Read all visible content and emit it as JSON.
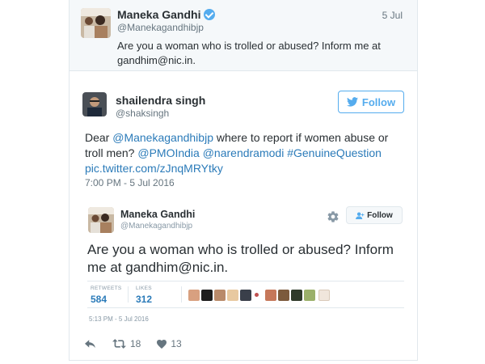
{
  "parent_tweet": {
    "name": "Maneka Gandhi",
    "handle": "@Manekagandhibjp",
    "date": "5 Jul",
    "text": "Are you a woman who is trolled or abused? Inform me at gandhim@nic.in."
  },
  "main_tweet": {
    "name": "shailendra singh",
    "handle": "@shaksingh",
    "follow_label": "Follow",
    "body": {
      "dear": "Dear ",
      "mention1": "@Manekagandhibjp",
      "text1": " where to report if women abuse or troll men? ",
      "mention2": "@PMOIndia",
      "space1": " ",
      "mention3": "@narendramodi",
      "space2": " ",
      "hashtag": "#GenuineQuestion",
      "link": "pic.twitter.com/zJnqMRYtky"
    },
    "timestamp": "7:00 PM - 5 Jul 2016",
    "replies_icon": "reply-icon",
    "retweet_count": "18",
    "like_count": "13"
  },
  "embedded_card": {
    "name": "Maneka Gandhi",
    "handle": "@Manekagandhibjp",
    "follow_label": "Follow",
    "text": "Are you a woman who is trolled or abused? Inform me at gandhim@nic.in.",
    "retweets_label": "RETWEETS",
    "retweets_value": "584",
    "likes_label": "LIKES",
    "likes_value": "312",
    "timestamp": "5:13 PM - 5 Jul 2016"
  },
  "colors": {
    "twitter_blue": "#55acee",
    "link_blue": "#2b7bb9",
    "muted": "#66757f",
    "parent_bg": "#f5f8fa"
  }
}
